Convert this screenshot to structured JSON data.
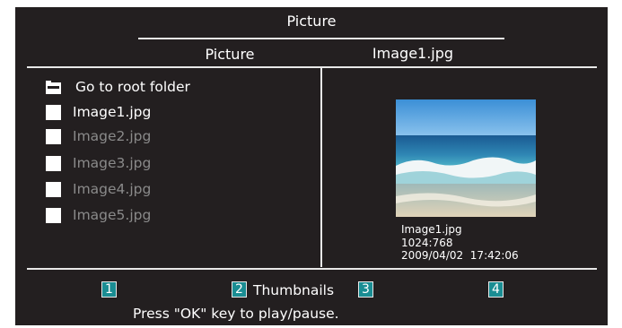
{
  "screen": {
    "title": "Picture"
  },
  "header": {
    "left_label": "Picture",
    "right_label": "Image1.jpg"
  },
  "file_list": {
    "root_folder_label": "Go to root folder",
    "items": [
      {
        "label": "Image1.jpg",
        "state": "selected"
      },
      {
        "label": "Image2.jpg",
        "state": "dimmed"
      },
      {
        "label": "Image3.jpg",
        "state": "dimmed"
      },
      {
        "label": "Image4.jpg",
        "state": "dimmed"
      },
      {
        "label": "Image5.jpg",
        "state": "dimmed"
      }
    ]
  },
  "preview": {
    "filename": "Image1.jpg",
    "resolution": "1024:768",
    "datetime": "2009/04/02  17:42:06",
    "image_icon": "beach-photo"
  },
  "footer": {
    "buttons": [
      {
        "number": "1",
        "label": ""
      },
      {
        "number": "2",
        "label": "Thumbnails"
      },
      {
        "number": "3",
        "label": ""
      },
      {
        "number": "4",
        "label": ""
      }
    ],
    "hint": "Press \"OK\" key to play/pause."
  },
  "colors": {
    "background": "#231f20",
    "button_teal": "#1a8d93",
    "dim_text": "#8a8a8a",
    "rule": "#e8e8e8"
  }
}
